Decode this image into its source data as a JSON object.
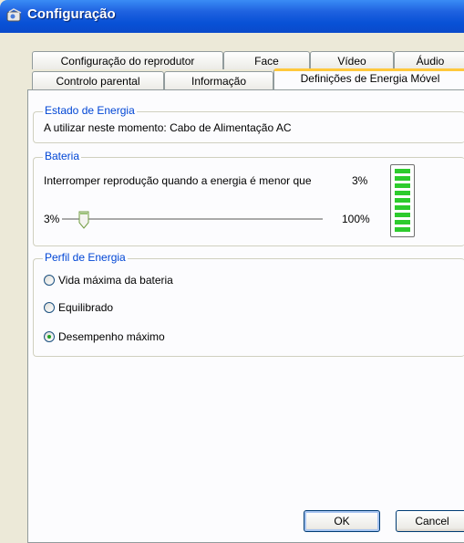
{
  "window": {
    "title": "Configuração"
  },
  "tabs": {
    "row_back": [
      "Configuração do reprodutor",
      "Face",
      "Vídeo",
      "Áudio"
    ],
    "row_front": [
      "Controlo parental",
      "Informação",
      "Definições de Energia Móvel"
    ]
  },
  "power_status": {
    "group_label": "Estado de Energia",
    "text": "A utilizar neste momento: Cabo de Alimentação AC"
  },
  "battery": {
    "group_label": "Bateria",
    "text": "Interromper reprodução quando a energia é menor que",
    "current_value": "3%",
    "slider_min": "3%",
    "slider_max": "100%",
    "slider_value_percent": 3,
    "charge_level_fraction": 1.0,
    "meter_color": "#2DCB2D"
  },
  "power_profile": {
    "group_label": "Perfil de Energia",
    "options": [
      "Vida máxima da bateria",
      "Equilibrado",
      "Desempenho máximo"
    ],
    "selected": "Desempenho máximo"
  },
  "buttons": {
    "ok": "OK",
    "cancel": "Cancel"
  },
  "colors": {
    "title_bar": "#0A4ACB",
    "group_label": "#0046D5",
    "active_tab_accent": "#FFC83C"
  }
}
